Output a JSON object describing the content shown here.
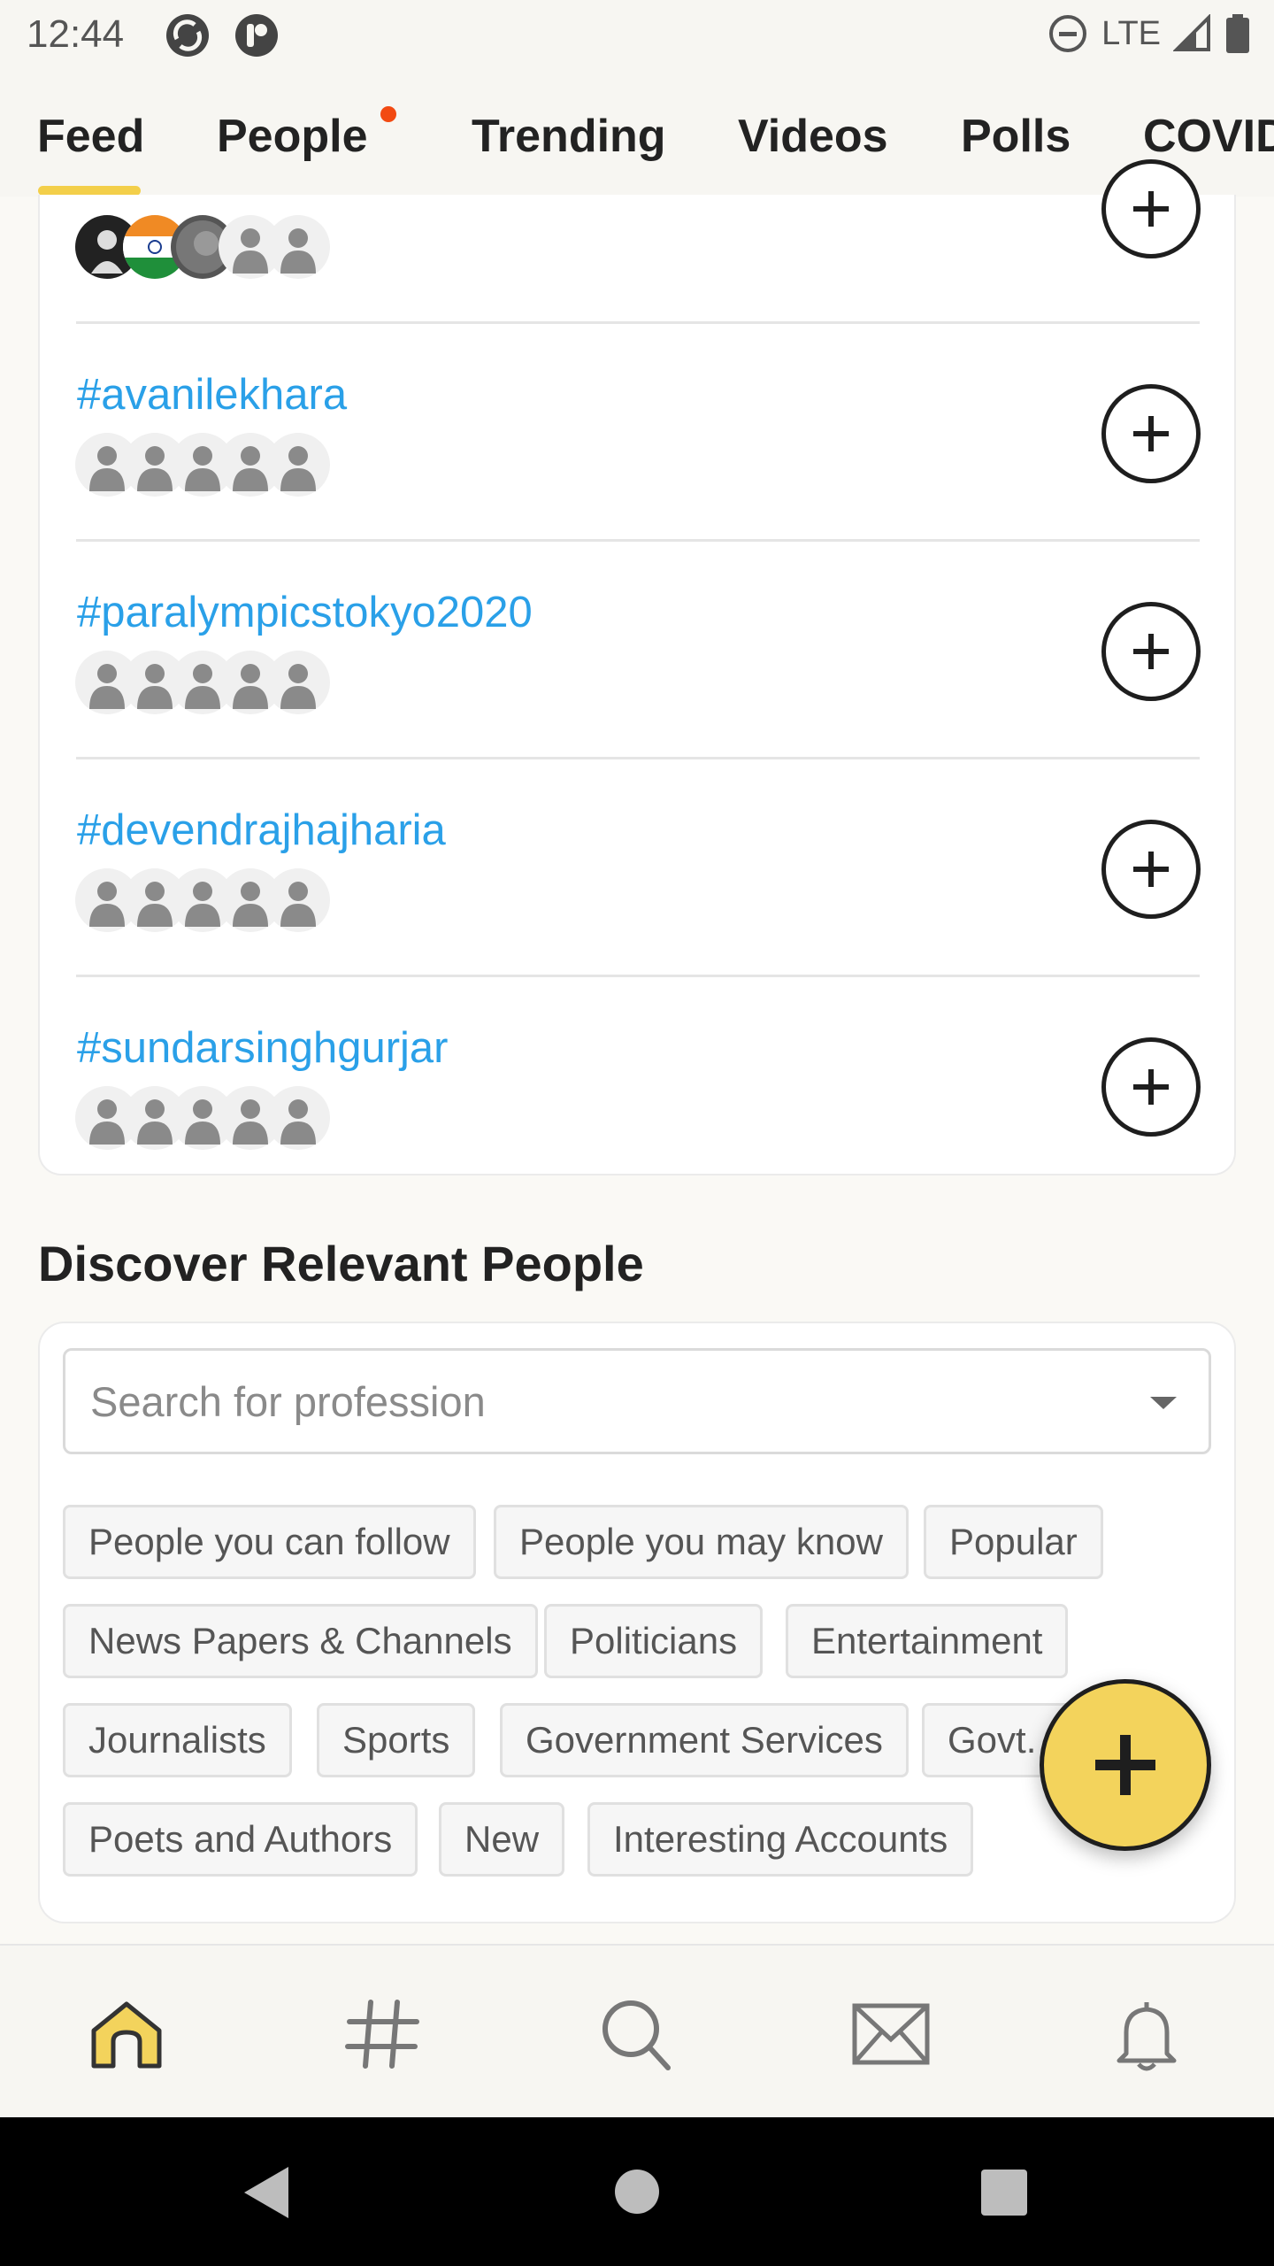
{
  "status_bar": {
    "time": "12:44",
    "network": "LTE",
    "icons": [
      "app-notification-icon",
      "app-koo-icon",
      "do-not-disturb-icon",
      "signal-icon",
      "battery-icon"
    ]
  },
  "tabs": [
    {
      "label": "Feed",
      "active": true
    },
    {
      "label": "People",
      "has_notification": true
    },
    {
      "label": "Trending"
    },
    {
      "label": "Videos"
    },
    {
      "label": "Polls"
    },
    {
      "label": "COVID"
    }
  ],
  "hashtags": [
    {
      "tag": "#avanilekhara"
    },
    {
      "tag": "#paralympicstokyo2020"
    },
    {
      "tag": "#devendrajhajharia"
    },
    {
      "tag": "#sundarsinghgurjar"
    }
  ],
  "discover": {
    "title": "Discover Relevant People",
    "search_placeholder": "Search for profession",
    "chips": [
      "People you can follow",
      "People you may know",
      "Popular",
      "News Papers & Channels",
      "Politicians",
      "Entertainment",
      "Journalists",
      "Sports",
      "Government Services",
      "Govt.",
      "Poets and Authors",
      "New",
      "Interesting Accounts"
    ]
  },
  "bottom_nav": [
    "home-icon",
    "hashtag-icon",
    "search-icon",
    "mail-icon",
    "bell-icon"
  ],
  "colors": {
    "accent": "#f3d35c",
    "hashtag": "#2aa0e8",
    "notification": "#f24a12"
  }
}
